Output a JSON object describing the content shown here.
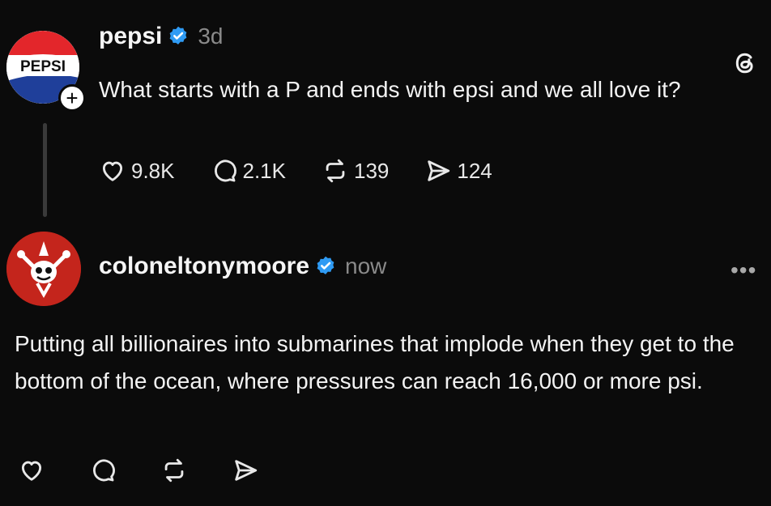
{
  "post1": {
    "avatar_text": "PEPSI",
    "username": "pepsi",
    "time": "3d",
    "body": "What starts with a P and ends with epsi and we all love it?",
    "likes": "9.8K",
    "replies": "2.1K",
    "reposts": "139",
    "shares": "124"
  },
  "post2": {
    "username": "coloneltonymoore",
    "time": "now",
    "more": "•••",
    "body": "Putting all billionaires into submarines that implode when they get to the bottom of the ocean, where pressures can reach 16,000 or more psi."
  },
  "icons": {
    "verified_color": "#2f9bf4",
    "pepsi_red": "#e3262b",
    "pepsi_blue": "#1f3f9a"
  }
}
